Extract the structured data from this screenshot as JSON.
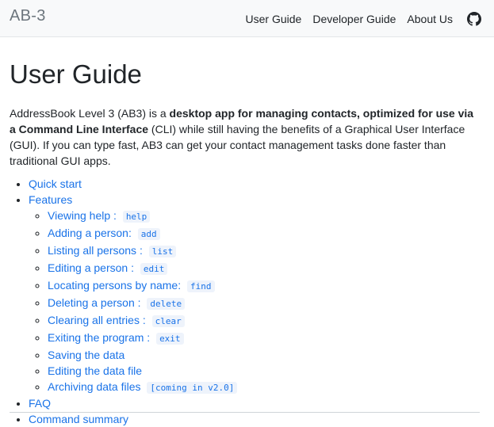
{
  "navbar": {
    "brand": "AB-3",
    "links": [
      "User Guide",
      "Developer Guide",
      "About Us"
    ],
    "github_icon": "github-icon"
  },
  "page": {
    "title": "User Guide",
    "intro": {
      "p1": "AddressBook Level 3 (AB3) is a ",
      "bold": "desktop app for managing contacts, optimized for use via a Command Line Interface",
      "p2": " (CLI) while still having the benefits of a Graphical User Interface (GUI). If you can type fast, AB3 can get your contact management tasks done faster than traditional GUI apps."
    }
  },
  "toc": {
    "quick_start": "Quick start",
    "features": "Features",
    "feature_items": [
      {
        "label": "Viewing help :",
        "code": "help"
      },
      {
        "label": "Adding a person:",
        "code": "add"
      },
      {
        "label": "Listing all persons :",
        "code": "list"
      },
      {
        "label": "Editing a person :",
        "code": "edit"
      },
      {
        "label": "Locating persons by name:",
        "code": "find"
      },
      {
        "label": "Deleting a person :",
        "code": "delete"
      },
      {
        "label": "Clearing all entries :",
        "code": "clear"
      },
      {
        "label": "Exiting the program :",
        "code": "exit"
      },
      {
        "label": "Saving the data",
        "code": ""
      },
      {
        "label": "Editing the data file",
        "code": ""
      },
      {
        "label": "Archiving data files",
        "code": "[coming in v2.0]"
      }
    ],
    "faq": "FAQ",
    "command_summary": "Command summary"
  }
}
